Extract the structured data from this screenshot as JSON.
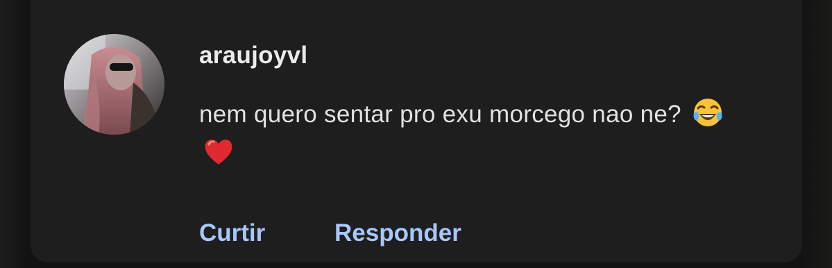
{
  "comment": {
    "username": "araujoyvl",
    "text": "nem quero sentar pro exu morcego nao ne?",
    "emojis": [
      "tears-of-joy-emoji",
      "red-heart-emoji"
    ],
    "avatar": "profile-photo"
  },
  "actions": {
    "like_label": "Curtir",
    "reply_label": "Responder"
  },
  "colors": {
    "background": "#121212",
    "card": "#1e1e1f",
    "text": "#e2e2e4",
    "action": "#a8c7fa"
  }
}
